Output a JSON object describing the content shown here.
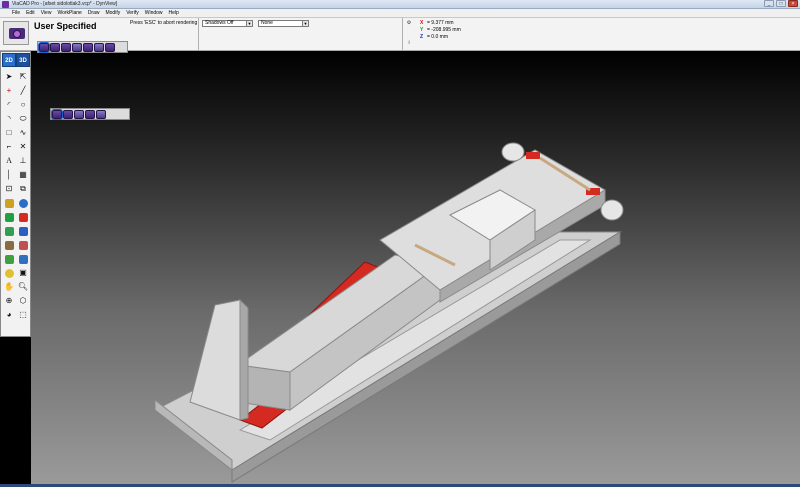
{
  "window": {
    "title": "ViaCAD Pro - [afset sidolotlak3.vcp* - DynView]",
    "minimize_label": "_",
    "maximize_label": "□",
    "close_label": "×"
  },
  "menu": [
    "File",
    "Edit",
    "View",
    "WorkPlane",
    "Draw",
    "Modify",
    "Verify",
    "Window",
    "Help"
  ],
  "render": {
    "mode_label": "User Specified",
    "hint": "Press 'ESC' to abort rendering",
    "shadows_value": "Shadows Off",
    "background_value": "None"
  },
  "coords": {
    "x_label": "X",
    "x_value": "= 9.377 mm",
    "y_label": "Y",
    "y_value": "= -208.995 mm",
    "z_label": "Z",
    "z_value": "= 0.0 mm"
  },
  "toolbox": {
    "tab_2d": "2D",
    "tab_3d": "3D",
    "text_tool": "A"
  },
  "colors": {
    "accent": "#2a6ec8",
    "model_gray": "#d4d4d4",
    "cylinder_red": "#d42a22"
  }
}
